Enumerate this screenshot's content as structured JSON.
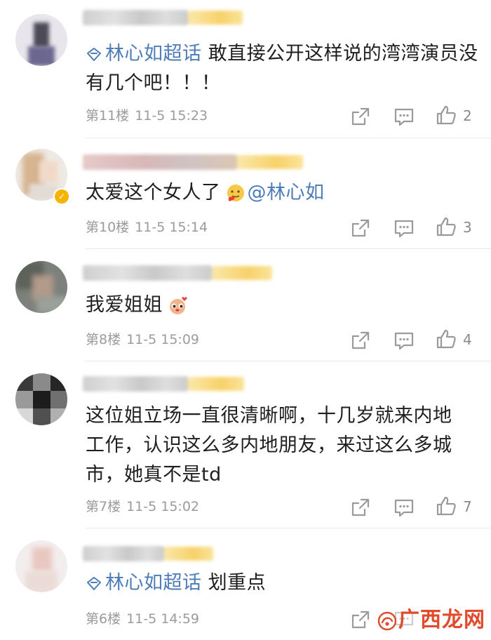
{
  "comments": [
    {
      "topic": "林心如超话",
      "text": "敢直接公开这样说的湾湾演员没有几个吧！！！",
      "floor": "第11楼",
      "time": "11-5 15:23",
      "likes": "2"
    },
    {
      "text": "太爱这个女人了",
      "mention": "@林心如",
      "floor": "第10楼",
      "time": "11-5 15:14",
      "likes": "3"
    },
    {
      "text": "我爱姐姐",
      "floor": "第8楼",
      "time": "11-5 15:09",
      "likes": "4"
    },
    {
      "text": "这位姐立场一直很清晰啊，十几岁就来内地工作，认识这么多内地朋友，来过这么多城市，她真不是td",
      "floor": "第7楼",
      "time": "11-5 15:02",
      "likes": "7"
    },
    {
      "topic": "林心如超话",
      "text": "划重点",
      "floor": "第6楼",
      "time": "11-5 14:59",
      "likes": ""
    }
  ],
  "watermark": "广西龙网",
  "colors": {
    "link": "#4e7cb8",
    "meta": "#9b9b9b",
    "badge": "#f6b400",
    "watermark": "#e24a2c"
  },
  "icons": {
    "topic": "diamond-topic-icon",
    "repost": "share-icon",
    "comment": "comment-icon",
    "like": "thumbs-up-icon",
    "verified": "verified-badge-icon"
  }
}
